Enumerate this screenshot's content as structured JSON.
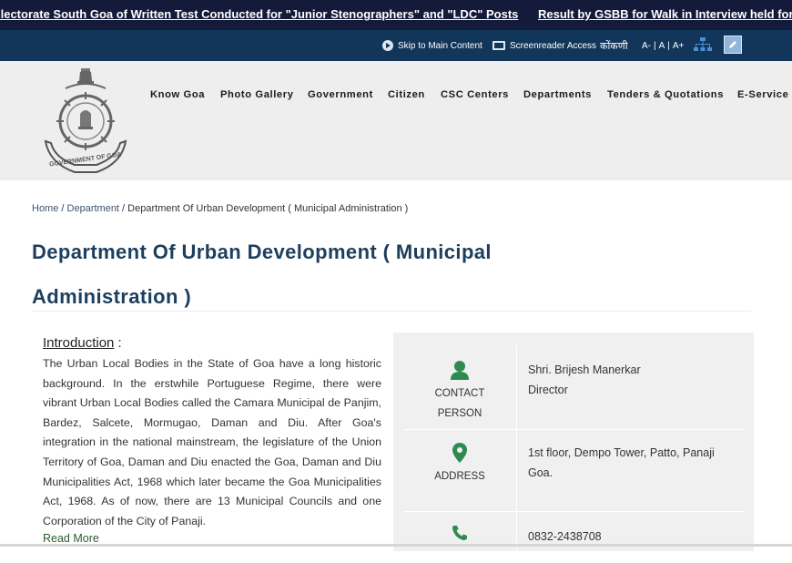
{
  "ticker": {
    "items": [
      "llectorate South Goa of Written Test Conducted for \"Junior Stenographers\" and \"LDC\" Posts",
      "Result by GSBB for Walk in Interview held for \"Mark"
    ]
  },
  "utility": {
    "skip": "Skip to Main Content",
    "screenreader": "Screenreader Access",
    "language": "कोंकणी",
    "font_decrease": "A-",
    "font_normal": "A",
    "font_increase": "A+",
    "sep": "|"
  },
  "logo": {
    "label": "GOVERNMENT OF GOA"
  },
  "nav": {
    "items": [
      "Know Goa",
      "Photo Gallery",
      "Government",
      "Citizen",
      "CSC Centers",
      "Departments",
      "Tenders & Quotations",
      "E-Service"
    ]
  },
  "breadcrumb": {
    "home": "Home",
    "sep": " / ",
    "department": "Department",
    "current": "Department Of Urban Development ( Municipal Administration )"
  },
  "page": {
    "title": "Department Of Urban Development ( Municipal Administration )"
  },
  "intro": {
    "heading": "Introduction",
    "colon": " :",
    "text": "The Urban Local Bodies in the State of Goa have a long historic background. In the erstwhile Portuguese Regime, there were vibrant Urban Local Bodies called the Camara Municipal de Panjim, Bardez, Salcete, Mormugao, Daman and Diu. After Goa's integration in the national mainstream, the legislature of the Union Territory of Goa, Daman and Diu enacted the Goa, Daman and Diu Municipalities Act, 1968 which later became the Goa Municipalities Act, 1968. As of now, there are 13 Municipal Councils and one Corporation of the City of Panaji.",
    "read_more": "Read More"
  },
  "contact": {
    "person_label_1": "CONTACT",
    "person_label_2": "PERSON",
    "person_name": "Shri. Brijesh Manerkar",
    "person_role": "Director",
    "address_label": "ADDRESS",
    "address_line1": "1st floor, Dempo Tower, Patto, Panaji",
    "address_line2": "Goa.",
    "phone": "0832-2438708"
  },
  "colors": {
    "ticker_bg": "#141b3a",
    "utility_bg": "#12365a",
    "title": "#1d3f5e",
    "icon_green": "#2f8a52"
  }
}
